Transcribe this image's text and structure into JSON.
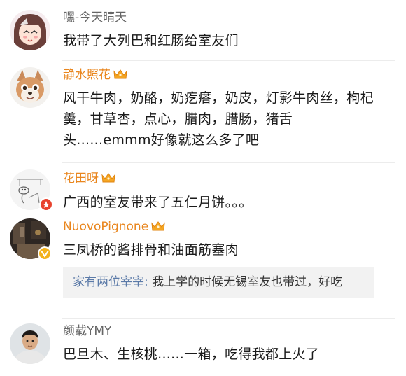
{
  "comments": [
    {
      "username": "嘿-今天晴天",
      "text": "我带了大列巴和红肠给室友们"
    },
    {
      "username": "静水照花",
      "crown_icon": "vip-crown-icon",
      "text": "风干牛肉，奶酪，奶疙瘩，奶皮，灯影牛肉丝，枸杞羹，甘草杏，点心，腊肉，腊肠，猪舌头......emmm好像就这么多了吧"
    },
    {
      "username": "花田呀",
      "crown_icon": "vip-crown-icon",
      "badge_icon": "red-verified-badge-icon",
      "text": "广西的室友带来了五仁月饼。。。"
    },
    {
      "username": "NuovoPignone",
      "crown_icon": "vip-crown-icon",
      "badge_icon": "yellow-verified-badge-icon",
      "text": "三凤桥的酱排骨和油面筋塞肉",
      "reply": {
        "author": "家有两位宰宰",
        "separator": ": ",
        "text": "我上学的时候无锡室友也带过，好吃"
      }
    },
    {
      "username": "颜载YMY",
      "text": "巴旦木、生核桃......一箱，吃得我都上火了"
    }
  ],
  "colors": {
    "vip_name": "#e9861e",
    "plain_name": "#666666",
    "reply_author": "#5b7aa8",
    "reply_bg": "#f2f2f2",
    "badge_red": "#e8432e",
    "badge_yellow": "#f3b21b"
  }
}
